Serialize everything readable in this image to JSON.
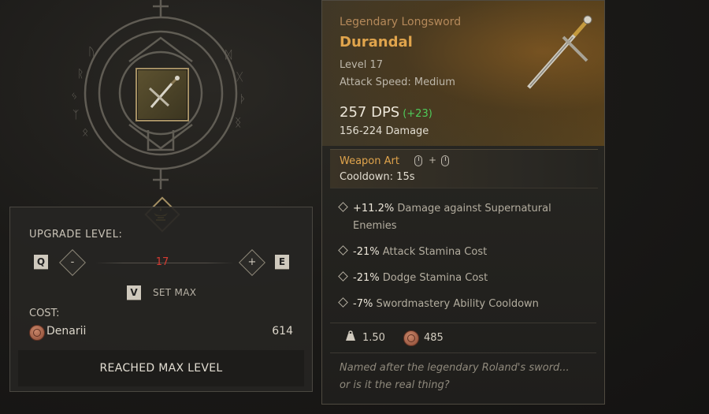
{
  "upgrade": {
    "level_label": "UPGRADE LEVEL:",
    "key_decrease": "Q",
    "decrease_symbol": "-",
    "level_value": "17",
    "increase_symbol": "+",
    "key_increase": "E",
    "key_setmax": "V",
    "setmax_label": "SET MAX",
    "cost_label": "COST:",
    "currency_name": "Denarii",
    "currency_icon": "denarii-coin-icon",
    "cost_value": "614",
    "max_button_label": "REACHED MAX LEVEL"
  },
  "tooltip": {
    "subtitle": "Legendary Longsword",
    "name": "Durandal",
    "level": "Level 17",
    "attack_speed": "Attack Speed: Medium",
    "dps": "257 DPS",
    "dps_delta": "(+23)",
    "damage": "156-224 Damage",
    "weapon_art_label": "Weapon Art",
    "weapon_art_plus": "+",
    "cooldown": "Cooldown: 15s",
    "stats": [
      {
        "value": "+11.2%",
        "text": "Damage against Supernatural Enemies"
      },
      {
        "value": "-21%",
        "text": "Attack Stamina Cost"
      },
      {
        "value": "-21%",
        "text": "Dodge Stamina Cost"
      },
      {
        "value": "-7%",
        "text": "Swordmastery Ability Cooldown"
      }
    ],
    "weight": "1.50",
    "gold_value": "485",
    "quote_line1": "Named after the legendary Roland's sword...",
    "quote_line2": "or is it the real thing?"
  },
  "colors": {
    "legendary_name": "#e0a44c",
    "level_value_red": "#d43b32",
    "dps_bonus_green": "#4fcb5a",
    "frame_gold": "#a48f63"
  }
}
